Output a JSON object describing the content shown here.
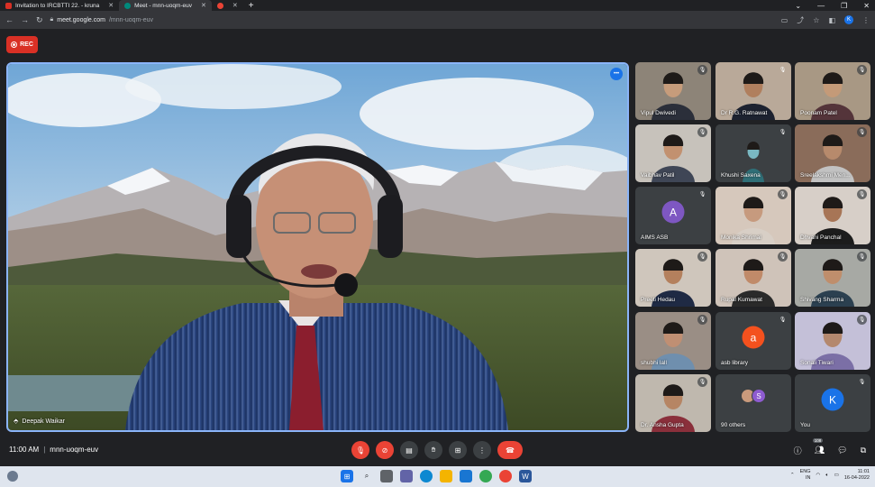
{
  "browser": {
    "tabs": [
      {
        "title": "Invitation to IRCBTTI 22. - kruna",
        "active": false,
        "color": "#d93025"
      },
      {
        "title": "Meet - mnn-uoqm-euv",
        "active": true,
        "color": "#00897b"
      },
      {
        "title": "",
        "active": false,
        "color": "#ea4335"
      }
    ],
    "new_tab": "+",
    "url_domain": "meet.google.com",
    "url_path": "/mnn-uoqm-euv",
    "profile_initial": "K"
  },
  "meet": {
    "rec_label": "REC",
    "main_speaker": "Deepak Waikar",
    "meeting_time": "11:00 AM",
    "meeting_code": "mnn-uoqm-euv",
    "participant_count": "108",
    "accent": "#8ab4f8",
    "participants": [
      {
        "name": "Vipul Dwivedi",
        "type": "video",
        "bg": "#8d8478",
        "skin": "#c69c7b",
        "shirt": "#2b2f3a"
      },
      {
        "name": "Dr R.G. Ratnawat",
        "type": "video",
        "bg": "#b9a999",
        "skin": "#b07f5e",
        "shirt": "#1d2230"
      },
      {
        "name": "Poonam Patel",
        "type": "video",
        "bg": "#a89884",
        "skin": "#c49a78",
        "shirt": "#54343a"
      },
      {
        "name": "Vaibhav  Patil",
        "type": "video",
        "bg": "#c7c2bb",
        "skin": "#c29170",
        "shirt": "#3f4656"
      },
      {
        "name": "Khushi Saxena",
        "type": "tiny",
        "bg": "#3c4043",
        "skin": "#7ab8c2",
        "shirt": "#2f6f77"
      },
      {
        "name": "Sreelakshmi Men...",
        "type": "video",
        "bg": "#8a6c5a",
        "skin": "#b78a6c",
        "shirt": "#c2c2c2"
      },
      {
        "name": "AIMS ASB",
        "type": "avatar",
        "initial": "A",
        "color": "#7e57c2"
      },
      {
        "name": "Monika Shrimal",
        "type": "video",
        "bg": "#d6c8bc",
        "skin": "#c69a7e",
        "shirt": "#d8cfc6"
      },
      {
        "name": "Dhvani Panchal",
        "type": "video",
        "bg": "#d7cfc8",
        "skin": "#a77556",
        "shirt": "#1c1c1c"
      },
      {
        "name": "Preeti Hedau",
        "type": "video",
        "bg": "#cfc6bc",
        "skin": "#b4805d",
        "shirt": "#1f2a44"
      },
      {
        "name": "Rupal Kumawat",
        "type": "video",
        "bg": "#cfc3b9",
        "skin": "#c08a69",
        "shirt": "#2a2a2a"
      },
      {
        "name": "Shivang Sharma",
        "type": "video",
        "bg": "#a7a9a4",
        "skin": "#bf8e6c",
        "shirt": "#2b4050"
      },
      {
        "name": "shubhi lall",
        "type": "video",
        "bg": "#9a8e85",
        "skin": "#c08f73",
        "shirt": "#6f8fae"
      },
      {
        "name": "asb library",
        "type": "avatar",
        "initial": "a",
        "color": "#f4511e"
      },
      {
        "name": "Sonali Tiwari",
        "type": "video",
        "bg": "#c4c0d8",
        "skin": "#b4886e",
        "shirt": "#7b6fa6"
      },
      {
        "name": "Dr. Ansha Gupta",
        "type": "video",
        "bg": "#bfb8ae",
        "skin": "#b68564",
        "shirt": "#8a2f3b"
      },
      {
        "name": "90 others",
        "type": "others",
        "initial": "S",
        "color": "#8e5bd0"
      },
      {
        "name": "You",
        "type": "avatar",
        "initial": "K",
        "color": "#1a73e8"
      }
    ]
  },
  "taskbar": {
    "lang_top": "ENG",
    "lang_bottom": "IN",
    "time": "11:01",
    "date": "16-04-2022"
  }
}
